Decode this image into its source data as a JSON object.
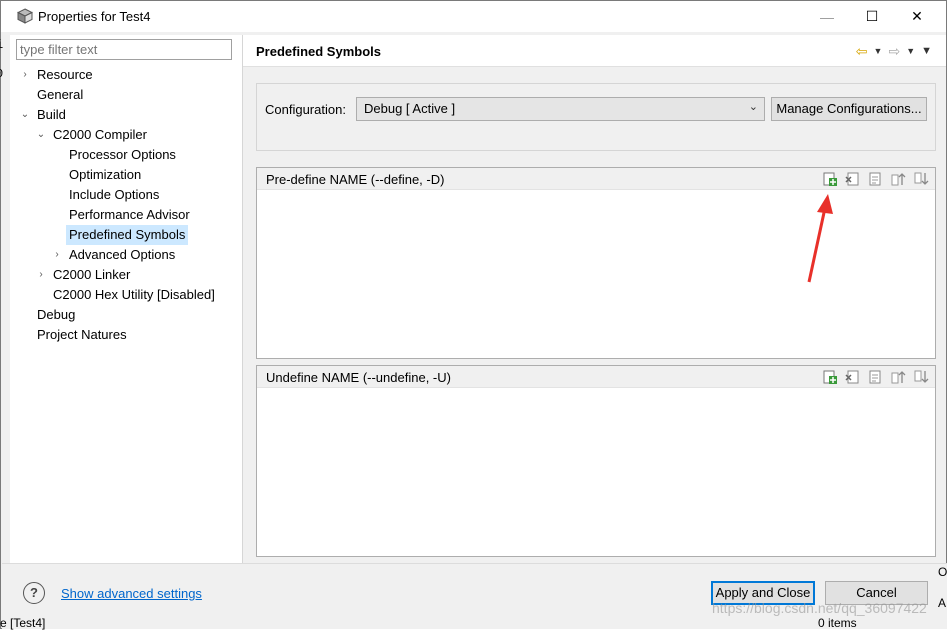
{
  "window": {
    "title": "Properties for Test4",
    "min": "—",
    "max": "☐",
    "close": "✕"
  },
  "left": {
    "filter_placeholder": "type filter text",
    "tree": {
      "resource": "Resource",
      "general": "General",
      "build": "Build",
      "compiler": "C2000 Compiler",
      "processor": "Processor Options",
      "optimization": "Optimization",
      "include": "Include Options",
      "perf": "Performance Advisor",
      "predefined": "Predefined Symbols",
      "advanced": "Advanced Options",
      "linker": "C2000 Linker",
      "hex": "C2000 Hex Utility  [Disabled]",
      "debug": "Debug",
      "natures": "Project Natures"
    }
  },
  "right": {
    "page_title": "Predefined Symbols",
    "config_label": "Configuration:",
    "config_value": "Debug  [ Active ]",
    "manage_button": "Manage Configurations...",
    "predefine_title": "Pre-define NAME (--define, -D)",
    "undefine_title": "Undefine NAME (--undefine, -U)"
  },
  "footer": {
    "help": "?",
    "advanced_link": "Show advanced settings",
    "apply_button": "Apply and Close",
    "cancel_button": "Cancel"
  },
  "background": {
    "left_char1": "i",
    "left_char2": "0",
    "right_char1": "O",
    "right_char2": "A",
    "bottom_left": "e [Test4]",
    "bottom_right": "0 items",
    "watermark": "https://blog.csdn.net/qq_36097422"
  },
  "colors": {
    "selection": "#cce8ff",
    "link": "#0066cc",
    "annotation_arrow": "#e8302a",
    "default_button_border": "#0078d7"
  }
}
